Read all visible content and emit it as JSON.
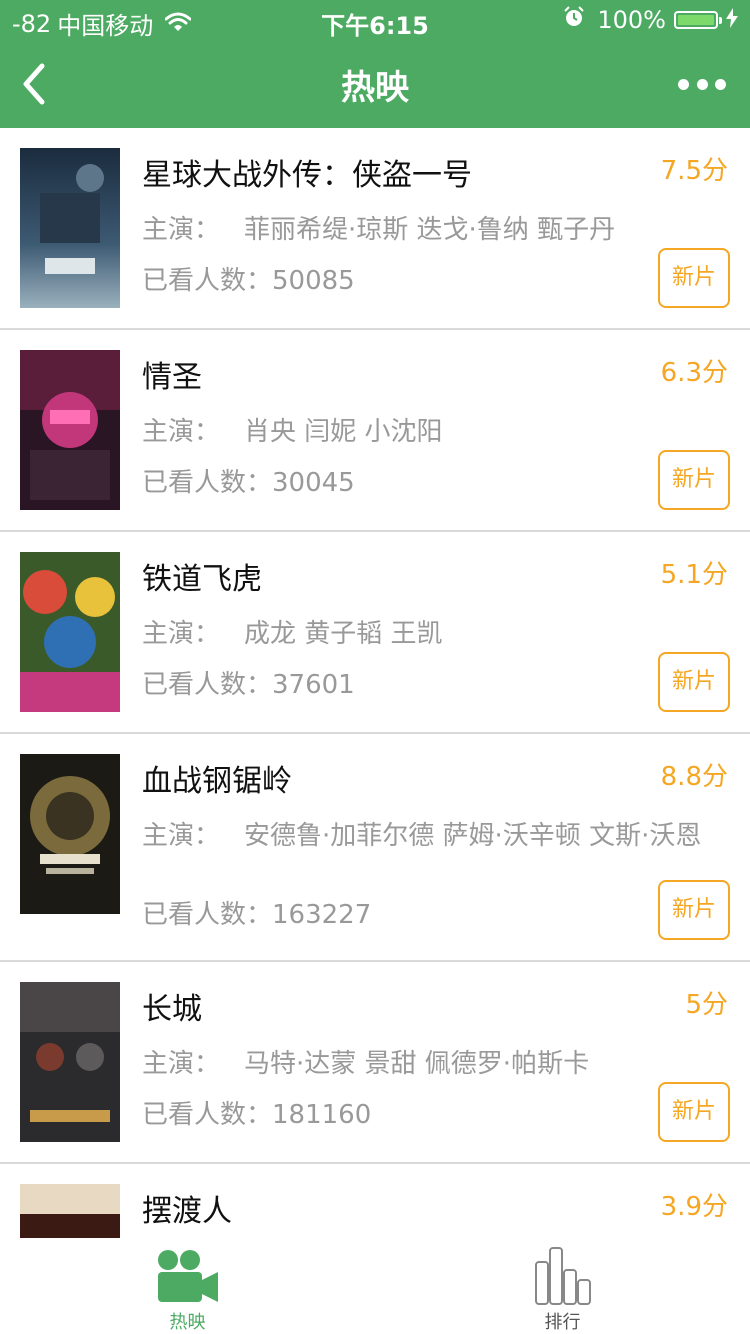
{
  "status_bar": {
    "signal": "-82",
    "carrier": "中国移动",
    "time": "下午6:15",
    "battery": "100%"
  },
  "nav": {
    "title": "热映"
  },
  "labels": {
    "cast_label": "主演：",
    "watched_label": "已看人数：",
    "badge": "新片"
  },
  "movies": [
    {
      "title": "星球大战外传：侠盗一号",
      "score": "7.5分",
      "cast": "菲丽希缇·琼斯 迭戈·鲁纳 甄子丹",
      "watched": "50085"
    },
    {
      "title": "情圣",
      "score": "6.3分",
      "cast": "肖央 闫妮 小沈阳",
      "watched": "30045"
    },
    {
      "title": "铁道飞虎",
      "score": "5.1分",
      "cast": "成龙 黄子韬 王凯",
      "watched": "37601"
    },
    {
      "title": "血战钢锯岭",
      "score": "8.8分",
      "cast": "安德鲁·加菲尔德 萨姆·沃辛顿 文斯·沃恩",
      "watched": "163227"
    },
    {
      "title": "长城",
      "score": "5分",
      "cast": "马特·达蒙 景甜 佩德罗·帕斯卡",
      "watched": "181160"
    },
    {
      "title": "摆渡人",
      "score": "3.9分"
    }
  ],
  "tabs": [
    {
      "label": "热映",
      "icon": "video-camera-icon",
      "active": true
    },
    {
      "label": "排行",
      "icon": "bar-chart-icon",
      "active": false
    }
  ],
  "colors": {
    "brand_green": "#4caa62",
    "accent_orange": "#f5a623",
    "text_gray": "#999999"
  }
}
